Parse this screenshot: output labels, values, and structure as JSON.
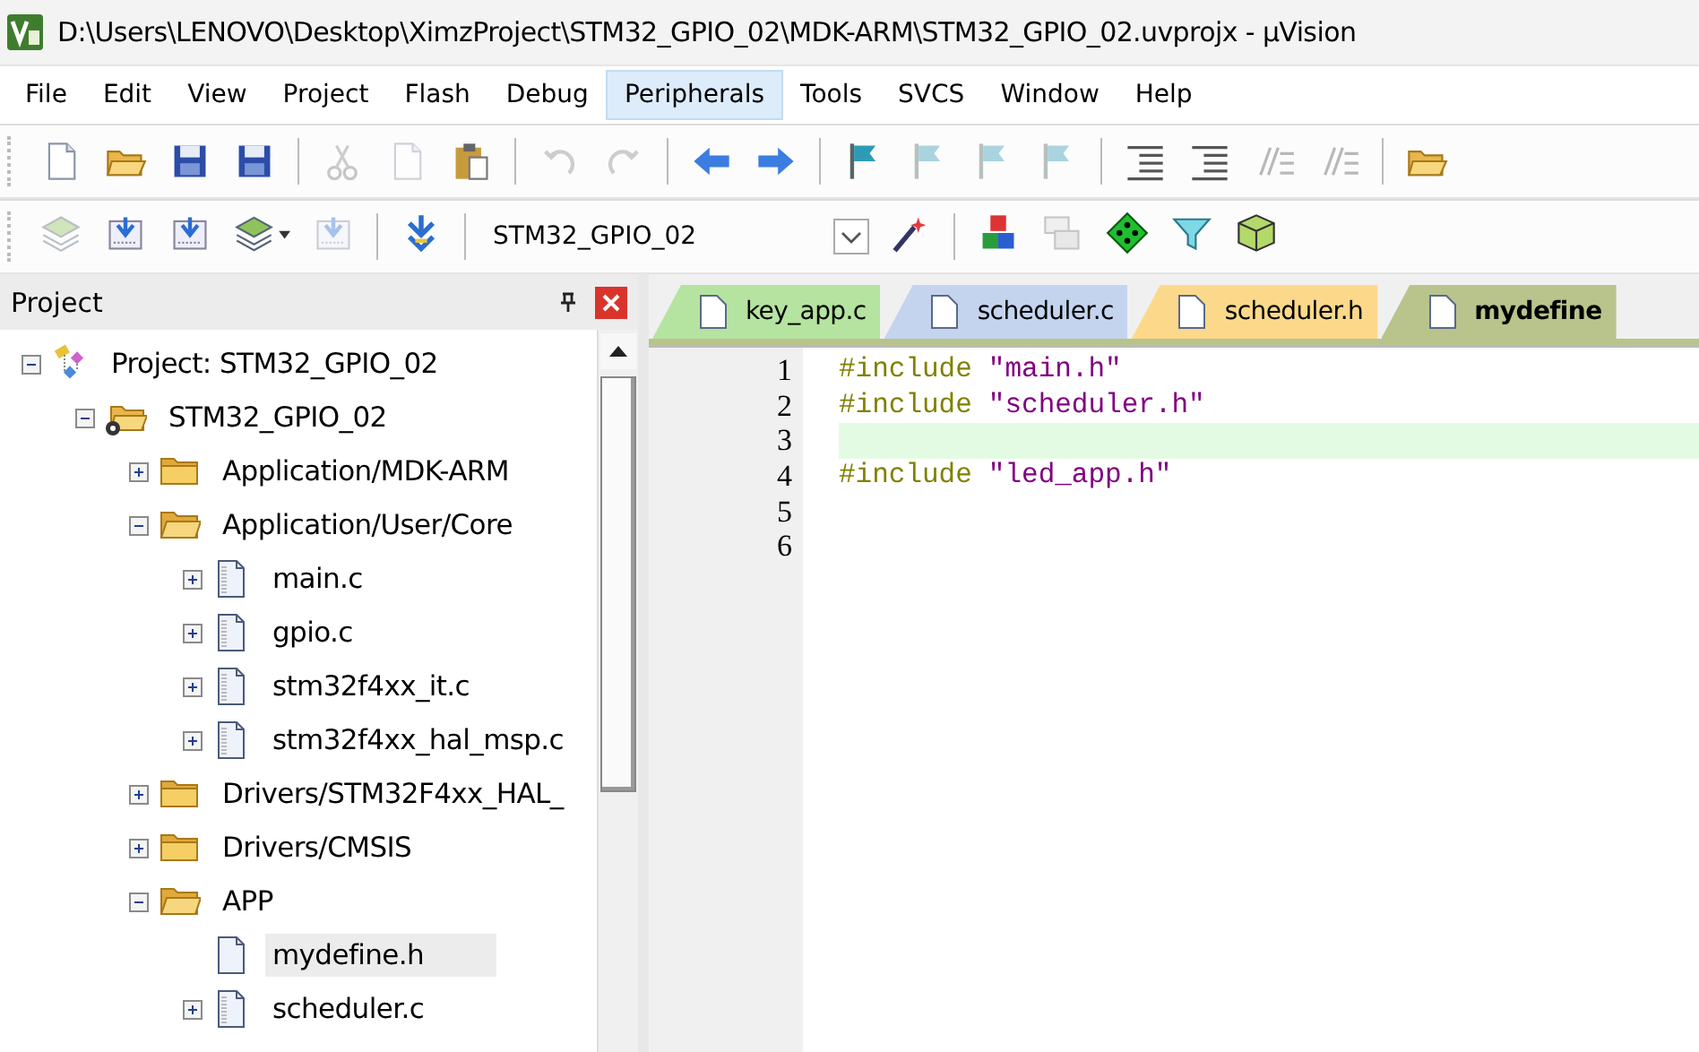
{
  "window": {
    "title": "D:\\Users\\LENOVO\\Desktop\\XimzProject\\STM32_GPIO_02\\MDK-ARM\\STM32_GPIO_02.uvprojx - µVision"
  },
  "menu": [
    {
      "label": "File",
      "selected": false
    },
    {
      "label": "Edit",
      "selected": false
    },
    {
      "label": "View",
      "selected": false
    },
    {
      "label": "Project",
      "selected": false
    },
    {
      "label": "Flash",
      "selected": false
    },
    {
      "label": "Debug",
      "selected": false
    },
    {
      "label": "Peripherals",
      "selected": true
    },
    {
      "label": "Tools",
      "selected": false
    },
    {
      "label": "SVCS",
      "selected": false
    },
    {
      "label": "Window",
      "selected": false
    },
    {
      "label": "Help",
      "selected": false
    }
  ],
  "toolbar_file": [
    {
      "kind": "button",
      "disabled": false
    },
    {
      "kind": "button",
      "disabled": false
    },
    {
      "kind": "button",
      "disabled": false
    },
    {
      "kind": "button",
      "disabled": false
    },
    {
      "kind": "separator"
    },
    {
      "kind": "button",
      "disabled": true
    },
    {
      "kind": "button",
      "disabled": true
    },
    {
      "kind": "button",
      "disabled": false
    },
    {
      "kind": "separator"
    },
    {
      "kind": "button",
      "disabled": true
    },
    {
      "kind": "button",
      "disabled": true
    },
    {
      "kind": "separator"
    },
    {
      "kind": "button",
      "disabled": false
    },
    {
      "kind": "button",
      "disabled": false
    },
    {
      "kind": "separator"
    },
    {
      "kind": "button",
      "disabled": false
    },
    {
      "kind": "button",
      "disabled": true
    },
    {
      "kind": "button",
      "disabled": true
    },
    {
      "kind": "button",
      "disabled": true
    },
    {
      "kind": "separator"
    },
    {
      "kind": "button",
      "disabled": false
    },
    {
      "kind": "button",
      "disabled": false
    },
    {
      "kind": "button",
      "disabled": true
    },
    {
      "kind": "button",
      "disabled": true
    },
    {
      "kind": "separator"
    },
    {
      "kind": "button",
      "disabled": false
    }
  ],
  "toolbar_build": {
    "target": "STM32_GPIO_02",
    "buttons": [
      {
        "kind": "button",
        "disabled": true
      },
      {
        "kind": "button",
        "disabled": false
      },
      {
        "kind": "button",
        "disabled": false
      },
      {
        "kind": "dropdown",
        "disabled": false
      },
      {
        "kind": "button",
        "disabled": true
      },
      {
        "kind": "separator"
      },
      {
        "kind": "button",
        "disabled": false
      },
      {
        "kind": "separator"
      },
      {
        "kind": "target"
      },
      {
        "kind": "button",
        "disabled": false
      },
      {
        "kind": "separator"
      },
      {
        "kind": "button",
        "disabled": false
      },
      {
        "kind": "button",
        "disabled": true
      },
      {
        "kind": "button",
        "disabled": false
      },
      {
        "kind": "button",
        "disabled": false
      },
      {
        "kind": "button",
        "disabled": false
      }
    ]
  },
  "project_panel": {
    "title": "Project",
    "tree": [
      {
        "label": "Project: STM32_GPIO_02",
        "kind": "project",
        "expanded": true,
        "selected": false,
        "children": [
          {
            "label": "STM32_GPIO_02",
            "kind": "target",
            "expanded": true,
            "selected": false,
            "children": [
              {
                "label": "Application/MDK-ARM",
                "kind": "folder",
                "expanded": false,
                "selected": false
              },
              {
                "label": "Application/User/Core",
                "kind": "folder",
                "expanded": true,
                "selected": false,
                "children": [
                  {
                    "label": "main.c",
                    "kind": "file",
                    "expanded": false,
                    "selected": false
                  },
                  {
                    "label": "gpio.c",
                    "kind": "file",
                    "expanded": false,
                    "selected": false
                  },
                  {
                    "label": "stm32f4xx_it.c",
                    "kind": "file",
                    "expanded": false,
                    "selected": false
                  },
                  {
                    "label": "stm32f4xx_hal_msp.c",
                    "kind": "file",
                    "expanded": false,
                    "selected": false
                  }
                ]
              },
              {
                "label": "Drivers/STM32F4xx_HAL_",
                "kind": "folder",
                "expanded": false,
                "selected": false
              },
              {
                "label": "Drivers/CMSIS",
                "kind": "folder",
                "expanded": false,
                "selected": false
              },
              {
                "label": "APP",
                "kind": "folder",
                "expanded": true,
                "selected": false,
                "children": [
                  {
                    "label": "mydefine.h",
                    "kind": "header",
                    "selected": true
                  },
                  {
                    "label": "scheduler.c",
                    "kind": "file",
                    "expanded": false,
                    "selected": false
                  }
                ]
              }
            ]
          }
        ]
      }
    ]
  },
  "editor": {
    "tabs": [
      {
        "label": "key_app.c",
        "color": "#b5e3a0",
        "selected": false
      },
      {
        "label": "scheduler.c",
        "color": "#c4d4ef",
        "selected": false
      },
      {
        "label": "scheduler.h",
        "color": "#fcd98a",
        "selected": false
      },
      {
        "label": "mydefine",
        "color": "#b8c48c",
        "selected": true
      }
    ],
    "lines": [
      {
        "number": "1",
        "directive": "#include",
        "string": "\"main.h\""
      },
      {
        "number": "2",
        "directive": "#include",
        "string": "\"scheduler.h\""
      },
      {
        "number": "3",
        "current": true
      },
      {
        "number": "4",
        "directive": "#include",
        "string": "\"led_app.h\""
      },
      {
        "number": "5"
      },
      {
        "number": "6"
      }
    ]
  }
}
